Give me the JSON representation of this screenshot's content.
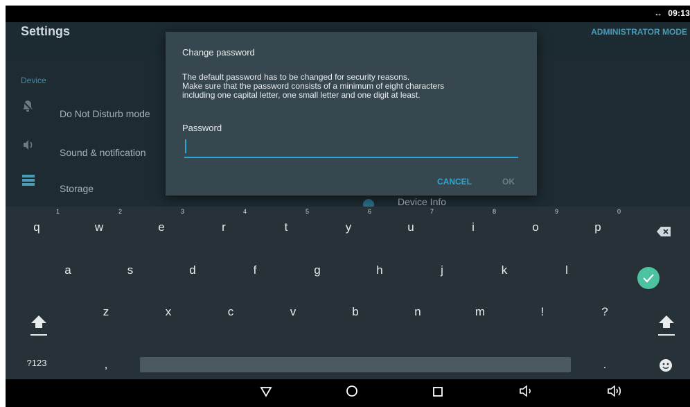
{
  "status_bar": {
    "sync_icon": "↔",
    "time": "09:13"
  },
  "app": {
    "title": "Settings",
    "mode_label": "ADMINISTRATOR MODE",
    "section": "Device",
    "items": [
      {
        "label": "Do Not Disturb mode",
        "icon": "bell-off-icon"
      },
      {
        "label": "Sound & notification",
        "icon": "volume-icon"
      },
      {
        "label": "Storage",
        "icon": "storage-icon"
      }
    ],
    "device_info_label": "Device Info"
  },
  "dialog": {
    "title": "Change password",
    "message_lines": [
      "The default password has to be changed for security reasons.",
      "Make sure that the password consists of a minimum of eight characters",
      "including one capital letter, one small letter and one digit at least."
    ],
    "password_label": "Password",
    "password_value": "",
    "cancel_label": "CANCEL",
    "ok_label": "OK"
  },
  "keyboard": {
    "row1": [
      {
        "k": "q",
        "h": "1"
      },
      {
        "k": "w",
        "h": "2"
      },
      {
        "k": "e",
        "h": "3"
      },
      {
        "k": "r",
        "h": "4"
      },
      {
        "k": "t",
        "h": "5"
      },
      {
        "k": "y",
        "h": "6"
      },
      {
        "k": "u",
        "h": "7"
      },
      {
        "k": "i",
        "h": "8"
      },
      {
        "k": "o",
        "h": "9"
      },
      {
        "k": "p",
        "h": "0"
      }
    ],
    "row2": [
      "a",
      "s",
      "d",
      "f",
      "g",
      "h",
      "j",
      "k",
      "l"
    ],
    "row3": [
      "z",
      "x",
      "c",
      "v",
      "b",
      "n",
      "m",
      "!",
      "?"
    ],
    "symbols_label": "?123",
    "comma": ",",
    "period": "."
  },
  "colors": {
    "accent": "#29a9d9",
    "done_key": "#4cc2a0"
  }
}
